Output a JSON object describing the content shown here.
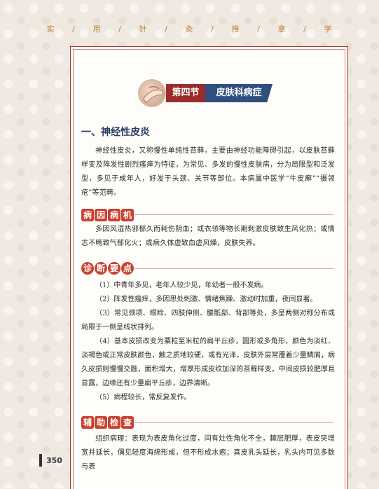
{
  "running_header": [
    "实",
    "用",
    "针",
    "灸",
    "推",
    "拿",
    "学"
  ],
  "section": {
    "number": "第四节",
    "title": "皮肤科病症"
  },
  "heading": "一、神经性皮炎",
  "intro": "神经性皮炎，又称慢性单纯性苔藓，主要由神经功能障碍引起，以皮肤苔藓样变及阵发性剧烈瘙痒为特征，为常见、多发的慢性皮肤病，分为局限型和泛发型，多见于成年人，好发于头颈、关节等部位。本病属中医学“牛皮癣”“摄领疮”等范畴。",
  "etiology": {
    "label": [
      "病",
      "因",
      "病",
      "机"
    ],
    "text": "多因风湿热邪郁久而耗伤阴血；或衣领等物长期刺激皮肤致生风化热；或情志不畅致气郁化火；或病久体虚致血虚风燥，皮肤失养。"
  },
  "diagnosis": {
    "label": [
      "诊",
      "断",
      "要",
      "点"
    ],
    "items": [
      "（1）中青年多见，老年人较少见，年幼者一般不发病。",
      "（2）阵发性瘙痒，多因思处刺激、情绪焦躁、激动时加重，夜间显著。",
      "（3）常见颈项、眼睑、四肢伸侧、腰骶部、背部等处，多呈两侧对称分布或局限于一侧呈线状排列。",
      "（4）基本皮损改变为粟粒至米粒的扁平丘疹，圆形或多角形，颜色为淡红、淡褐色或正常皮肤颜色，触之质地较硬，或有光泽，皮肤外层常覆着少量鳞屑，病久皮损则慢慢交融，面积增大，增厚形成皮纹加深的苔藓样变，中间皮损较肥厚且显露，边缘还有少量扁平丘疹，边界清晰。",
      "（5）病程较长，常反复发作。"
    ]
  },
  "auxiliary": {
    "label": [
      "辅",
      "助",
      "检",
      "查"
    ],
    "text": "组织病理：表现为表皮角化过度，间有灶性角化不全，棘层肥厚，表皮突增宽并延长，偶见轻度海绵形成，但不形成水疱；真皮乳头延长，乳头内可见多数与表"
  },
  "page_number": "350",
  "colors": {
    "accent_red": "#c9412f",
    "frame_red": "#9b3b2f",
    "navy": "#2f4f7f",
    "gold": "#b8802a"
  }
}
